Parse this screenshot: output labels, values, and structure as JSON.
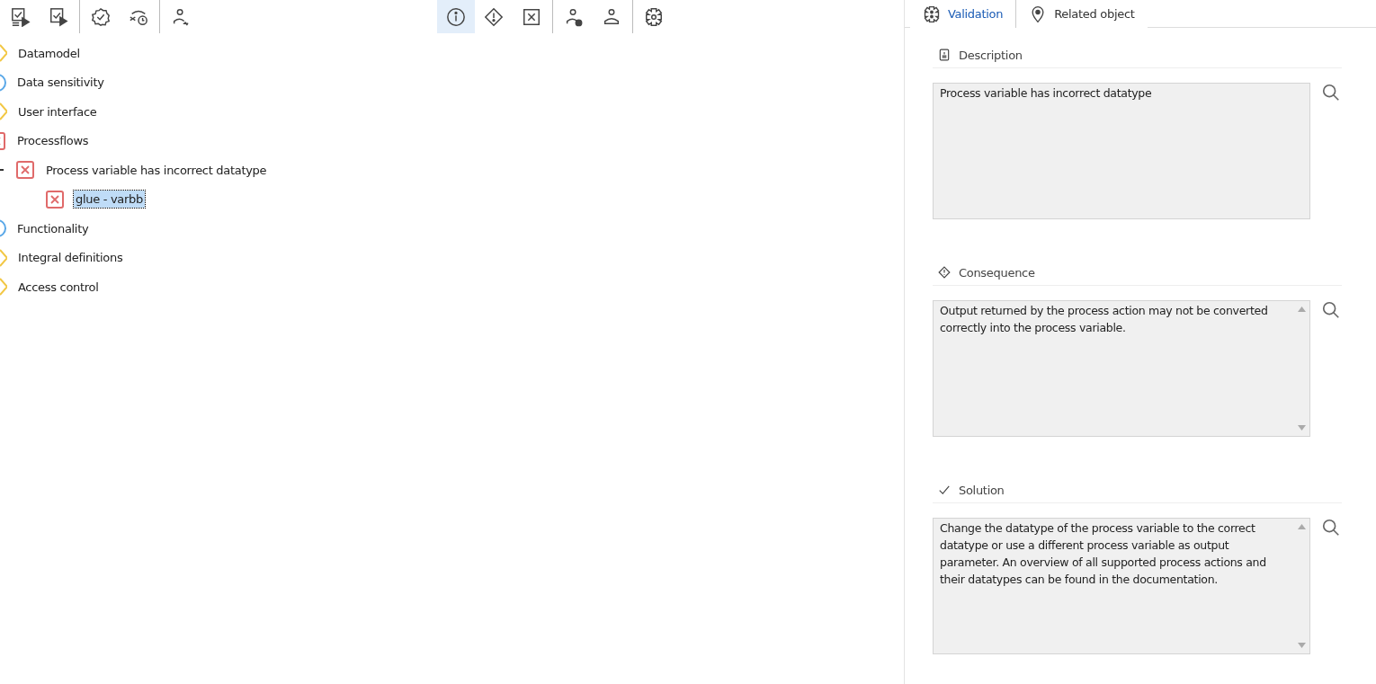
{
  "toolbar": {
    "groups": [
      [
        {
          "kind": "validate-run",
          "selected": false
        },
        {
          "kind": "validate-run-small",
          "selected": false
        }
      ],
      [
        {
          "kind": "badge-check",
          "selected": false
        },
        {
          "kind": "timer",
          "selected": false
        }
      ],
      [
        {
          "kind": "user-link",
          "selected": false
        }
      ],
      [
        {
          "kind": "info",
          "selected": true
        },
        {
          "kind": "warning",
          "selected": false
        },
        {
          "kind": "error",
          "selected": false
        }
      ],
      [
        {
          "kind": "user-question",
          "selected": false
        },
        {
          "kind": "user",
          "selected": false
        }
      ],
      [
        {
          "kind": "gear",
          "selected": false
        }
      ]
    ]
  },
  "tree": [
    {
      "label": "Datamodel",
      "kind": "warning",
      "selected": false
    },
    {
      "label": "Data sensitivity",
      "kind": "info",
      "selected": false
    },
    {
      "label": "User interface",
      "kind": "warning",
      "selected": false
    },
    {
      "label": "Processflows",
      "kind": "error",
      "selected": false,
      "children": [
        {
          "label": "Process variable has incorrect datatype",
          "kind": "error",
          "expanded": true,
          "selected": false,
          "children": [
            {
              "label": "glue - varbb",
              "kind": "error",
              "selected": true
            }
          ]
        }
      ]
    },
    {
      "label": "Functionality",
      "kind": "info",
      "selected": false
    },
    {
      "label": "Integral definitions",
      "kind": "warning",
      "selected": false
    },
    {
      "label": "Access control",
      "kind": "warning",
      "selected": false
    }
  ],
  "tabs": [
    {
      "label": "Validation",
      "kind": "validation",
      "selected": true
    },
    {
      "label": "Related object",
      "kind": "location",
      "selected": false
    }
  ],
  "sections": [
    {
      "title": "Description",
      "kind": "document",
      "text": "Process variable has incorrect datatype"
    },
    {
      "title": "Consequence",
      "kind": "warning",
      "text": "Output returned by the process action may not be converted correctly into the process variable.",
      "scrollable": true
    },
    {
      "title": "Solution",
      "kind": "check",
      "text": "Change the datatype of the process variable to the correct datatype or use a different process variable as output parameter. An overview of all supported process actions and their datatypes can be found in the documentation.",
      "scrollable": true
    }
  ]
}
